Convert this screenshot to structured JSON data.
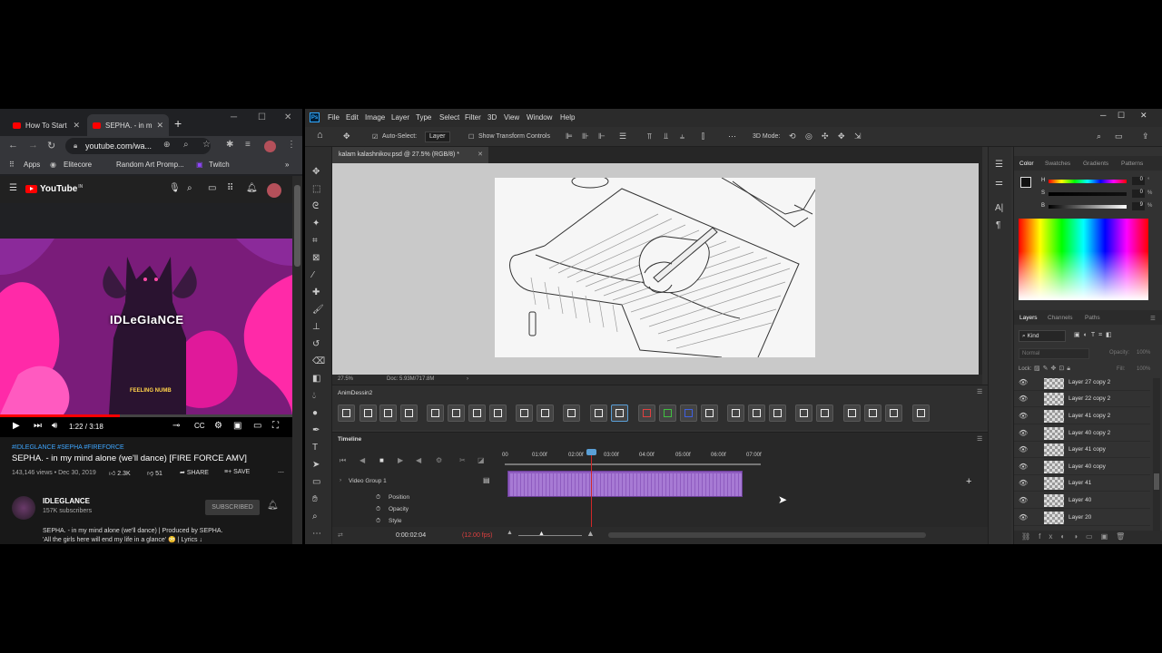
{
  "browser": {
    "tabs": [
      {
        "label": "How To Start"
      },
      {
        "label": "SEPHA. - in m"
      }
    ],
    "new_tab": "+",
    "url": "youtube.com/wa...",
    "bookmarks": [
      "Apps",
      "Elitecore",
      "Random Art Promp...",
      "Twitch"
    ],
    "bookmarks_more": "»"
  },
  "youtube": {
    "logo": "YouTube",
    "country": "IN",
    "video_logo_text": "IDLeGIaNCE",
    "video_subtext": "FEELING NUMB",
    "current_time": "1:22 / 3:18",
    "progress_fraction": 0.41,
    "hashtags": "#IDLEGLANCE #SEPHA #FIREFORCE",
    "title": "SEPHA. - in my mind alone (we'll dance) [FIRE FORCE AMV]",
    "views_date": "143,146 views • Dec 30, 2019",
    "likes": "2.3K",
    "dislikes": "51",
    "share": "SHARE",
    "save": "SAVE",
    "channel_name": "IDLEGLANCE",
    "channel_subs": "157K subscribers",
    "subscribed": "SUBSCRIBED",
    "description": "SEPHA. - in my mind alone (we'll dance) | Produced by SEPHA.\n'All the girls here will end my life in a glance' 😳 | Lyrics ↓"
  },
  "photoshop": {
    "menu": [
      "File",
      "Edit",
      "Image",
      "Layer",
      "Type",
      "Select",
      "Filter",
      "3D",
      "View",
      "Window",
      "Help"
    ],
    "options": {
      "auto_select": "Auto-Select:",
      "auto_select_target": "Layer",
      "show_transform": "Show Transform Controls",
      "mode_3d": "3D Mode:"
    },
    "document_tab": "kalam kalashnikov.psd @ 27.5% (RGB/8) *",
    "zoom": "27.5%",
    "doc_size": "Doc: 5.93M/717.8M",
    "anim_panel": "AnimDessin2",
    "timeline": {
      "title": "Timeline",
      "ruler": [
        "00",
        "01:00f",
        "02:00f",
        "03:00f",
        "04:00f",
        "05:00f",
        "06:00f",
        "07:00f"
      ],
      "group": "Video Group 1",
      "props": [
        "Position",
        "Opacity",
        "Style"
      ],
      "current_time": "0:00:02:04",
      "fps": "(12.00 fps)"
    },
    "color_panel": {
      "tabs": [
        "Color",
        "Swatches",
        "Gradients",
        "Patterns"
      ],
      "h": {
        "label": "H",
        "value": "0",
        "unit": "°"
      },
      "s": {
        "label": "S",
        "value": "0",
        "unit": "%"
      },
      "b": {
        "label": "B",
        "value": "9",
        "unit": "%"
      }
    },
    "layers_panel": {
      "tabs": [
        "Layers",
        "Channels",
        "Paths"
      ],
      "filter": "Kind",
      "blend": "Normal",
      "opacity_label": "Opacity:",
      "opacity": "100%",
      "lock_label": "Lock:",
      "fill_label": "Fill:",
      "fill": "100%",
      "layers": [
        "Layer 27 copy 2",
        "Layer 22 copy 2",
        "Layer 41 copy 2",
        "Layer 40 copy 2",
        "Layer 41 copy",
        "Layer 40 copy",
        "Layer 41",
        "Layer 40",
        "Layer 20"
      ]
    }
  },
  "colors": {
    "accent_blue": "#31a8ff",
    "clip_purple": "#8f5cc0",
    "youtube_red": "#ff0000"
  }
}
